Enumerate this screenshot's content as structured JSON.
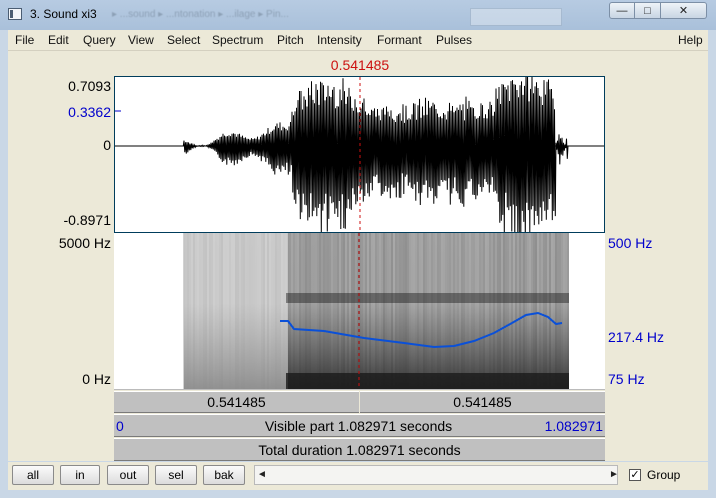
{
  "window": {
    "title": "3. Sound xi3",
    "ghost_text": "▸ ...sound ▸ ...ntonation ▸ ...ilage ▸ Pin...",
    "buttons": {
      "minimize": "—",
      "maximize": "□",
      "close": "✕"
    }
  },
  "menu": [
    "File",
    "Edit",
    "Query",
    "View",
    "Select",
    "Spectrum",
    "Pitch",
    "Intensity",
    "Formant",
    "Pulses",
    "Help"
  ],
  "cursor_time": "0.541485",
  "waveform": {
    "y_max": "0.7093",
    "y_cursor": "0.3362",
    "y_zero": "0",
    "y_min": "-0.8971"
  },
  "spectrogram": {
    "freq_top": "5000 Hz",
    "freq_bottom": "0 Hz",
    "pitch_top": "500 Hz",
    "pitch_cursor": "217.4 Hz",
    "pitch_bottom": "75 Hz"
  },
  "time_bars": {
    "left_segment": "0.541485",
    "right_segment": "0.541485",
    "visible_start": "0",
    "visible_label": "Visible part 1.082971 seconds",
    "visible_end": "1.082971",
    "total_label": "Total duration 1.082971 seconds"
  },
  "buttons": {
    "all": "all",
    "in": "in",
    "out": "out",
    "sel": "sel",
    "bak": "bak"
  },
  "scroll": {
    "left": "◄",
    "right": "►"
  },
  "group": {
    "label": "Group",
    "checked": "✓"
  },
  "colors": {
    "cursor": "#cc1010",
    "pitch": "#0a50d8",
    "axis_blue": "#0000cc"
  }
}
